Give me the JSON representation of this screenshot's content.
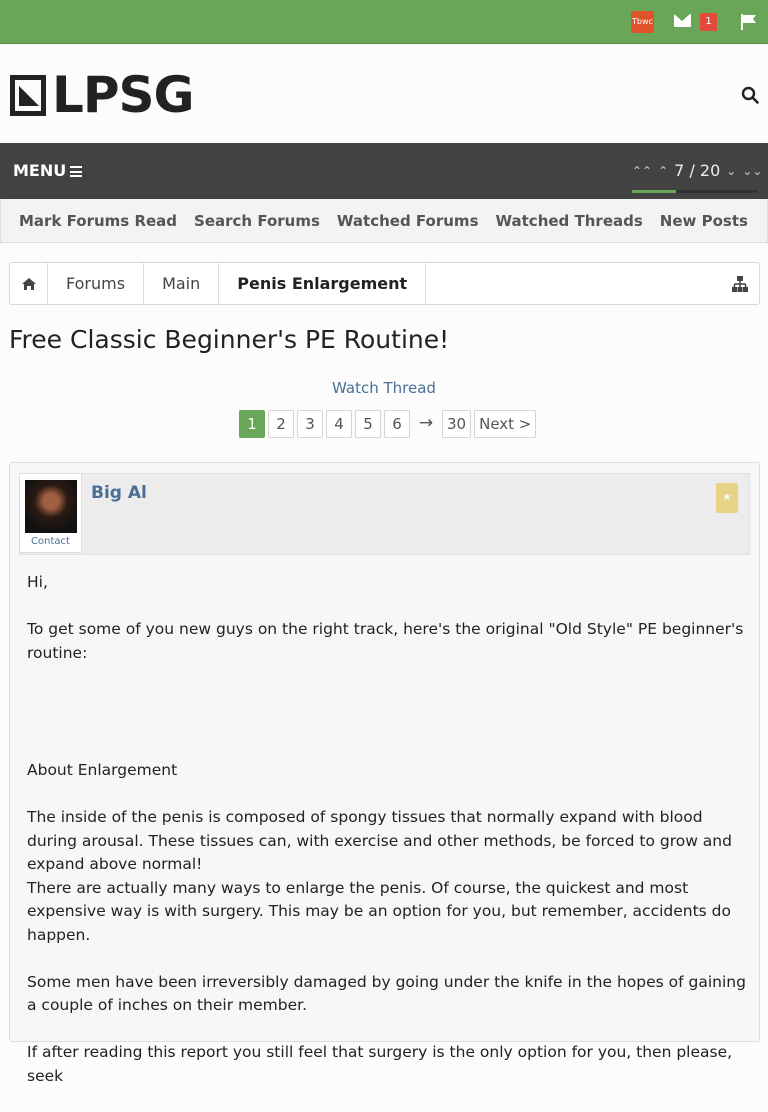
{
  "topbar": {
    "avatar_text": "Tbwc",
    "inbox_count": "1",
    "accent": "#6aa658"
  },
  "header": {
    "logo_text": "LPSG"
  },
  "menubar": {
    "menu_label": "MENU",
    "page_indicator": "7 / 20",
    "progress_fraction": 0.35
  },
  "subnav": {
    "items": [
      "Mark Forums Read",
      "Search Forums",
      "Watched Forums",
      "Watched Threads",
      "New Posts"
    ]
  },
  "breadcrumb": {
    "items": [
      "Forums",
      "Main",
      "Penis Enlargement"
    ]
  },
  "thread": {
    "title": "Free Classic Beginner's PE Routine!",
    "watch_label": "Watch Thread"
  },
  "pagination": {
    "pages": [
      "1",
      "2",
      "3",
      "4",
      "5",
      "6"
    ],
    "arrow": "→",
    "last": "30",
    "next": "Next >"
  },
  "post": {
    "author": "Big Al",
    "contact_label": "Contact",
    "paragraphs": [
      "Hi,",
      "To get some of you new guys on the right track, here's the original \"Old Style\" PE beginner's routine:",
      "",
      "About Enlargement",
      "The inside of the penis is composed of spongy tissues that normally expand with blood during arousal. These tissues can, with exercise and other methods, be forced to grow and expand above normal!",
      "There are actually many ways to enlarge the penis. Of course, the quickest and most expensive way is with surgery. This may be an option for you, but remember, accidents do happen.",
      "Some men have been irreversibly damaged by going under the knife in the hopes of gaining a couple of inches on their member.",
      "If after reading this report you still feel that surgery is the only option for you, then please, seek"
    ]
  }
}
